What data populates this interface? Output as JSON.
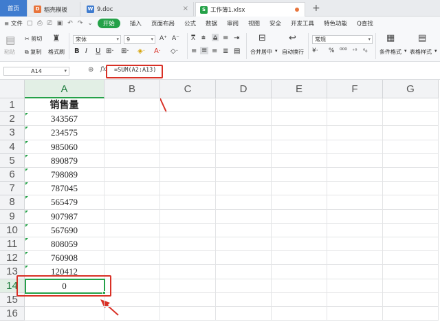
{
  "tabs": {
    "home": "首页",
    "t1": "稻壳模板",
    "t2": "9.doc",
    "t3": "工作簿1.xlsx",
    "add": "+"
  },
  "menu": {
    "file": "≡ 文件",
    "start": "开始",
    "items": [
      "插入",
      "页面布局",
      "公式",
      "数据",
      "审阅",
      "视图",
      "安全",
      "开发工具",
      "特色功能"
    ],
    "search": "Q查找"
  },
  "ribbon": {
    "paste": "粘贴",
    "cut": "剪切",
    "copy": "复制",
    "format_painter": "格式刷",
    "font_name": "宋体",
    "font_size": "9",
    "merge": "合并居中",
    "wrap": "自动换行",
    "number_format": "常规",
    "cond_format": "条件格式",
    "table_style": "表格样式"
  },
  "formula_bar": {
    "name_box": "A14",
    "formula": "=SUM(A2:A13)"
  },
  "columns": [
    "A",
    "B",
    "C",
    "D",
    "E",
    "F",
    "G"
  ],
  "rows": [
    "1",
    "2",
    "3",
    "4",
    "5",
    "6",
    "7",
    "8",
    "9",
    "10",
    "11",
    "12",
    "13",
    "14",
    "15",
    "16"
  ],
  "cells_A": [
    "销售量",
    "343567",
    "234575",
    "985060",
    "890879",
    "798089",
    "787045",
    "565479",
    "907987",
    "567690",
    "808059",
    "760908",
    "120412",
    "0",
    "",
    ""
  ],
  "colors": {
    "accent_green": "#24a148",
    "highlight_red": "#d93025",
    "home_tab": "#3f7ccf"
  }
}
